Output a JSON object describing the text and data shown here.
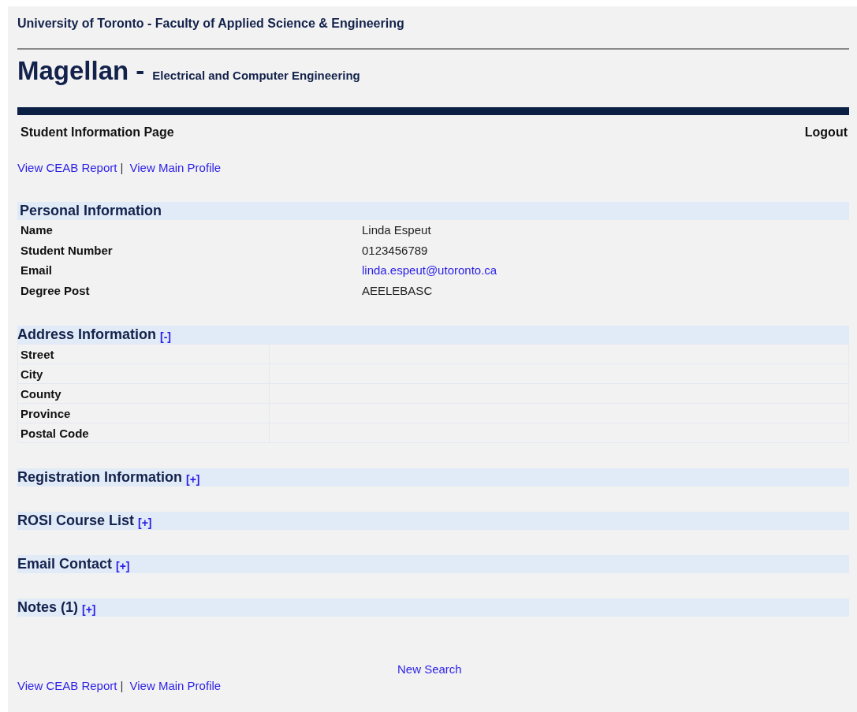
{
  "header": {
    "faculty": "University of Toronto - Faculty of Applied Science & Engineering",
    "app_name": "Magellan -",
    "department": "Electrical and Computer Engineering"
  },
  "nav": {
    "page_title": "Student Information Page",
    "logout": "Logout"
  },
  "top_links": [
    "View CEAB Report",
    "View Main Profile"
  ],
  "link_separator": "|",
  "sections": [
    {
      "kind": "fields",
      "title": "Personal Information",
      "fields": [
        {
          "label": "Name",
          "value": "Linda Espeut",
          "kind": "text"
        },
        {
          "label": "Student Number",
          "value": "0123456789",
          "kind": "text"
        },
        {
          "label": "Email",
          "value": "linda.espeut@utoronto.ca",
          "kind": "link"
        },
        {
          "label": "Degree Post",
          "value": "AEELEBASC",
          "kind": "text"
        }
      ]
    },
    {
      "kind": "table",
      "title": "Address Information",
      "toggle": "[-]",
      "rows": [
        {
          "label": "Street"
        },
        {
          "label": "City"
        },
        {
          "label": "County"
        },
        {
          "label": "Province"
        },
        {
          "label": "Postal Code"
        }
      ]
    },
    {
      "kind": "table",
      "title": "Registration Information",
      "toggle": "[+]"
    },
    {
      "kind": "table",
      "title": "ROSI Course List",
      "toggle": "[+]"
    },
    {
      "kind": "table",
      "title": "Email Contact",
      "toggle": "[+]"
    },
    {
      "kind": "table",
      "title": "Notes (1)",
      "toggle": "[+]"
    }
  ],
  "footer": {
    "new_search": "New Search",
    "links": [
      "View CEAB Report",
      "View Main Profile"
    ],
    "link_separator": "|"
  }
}
